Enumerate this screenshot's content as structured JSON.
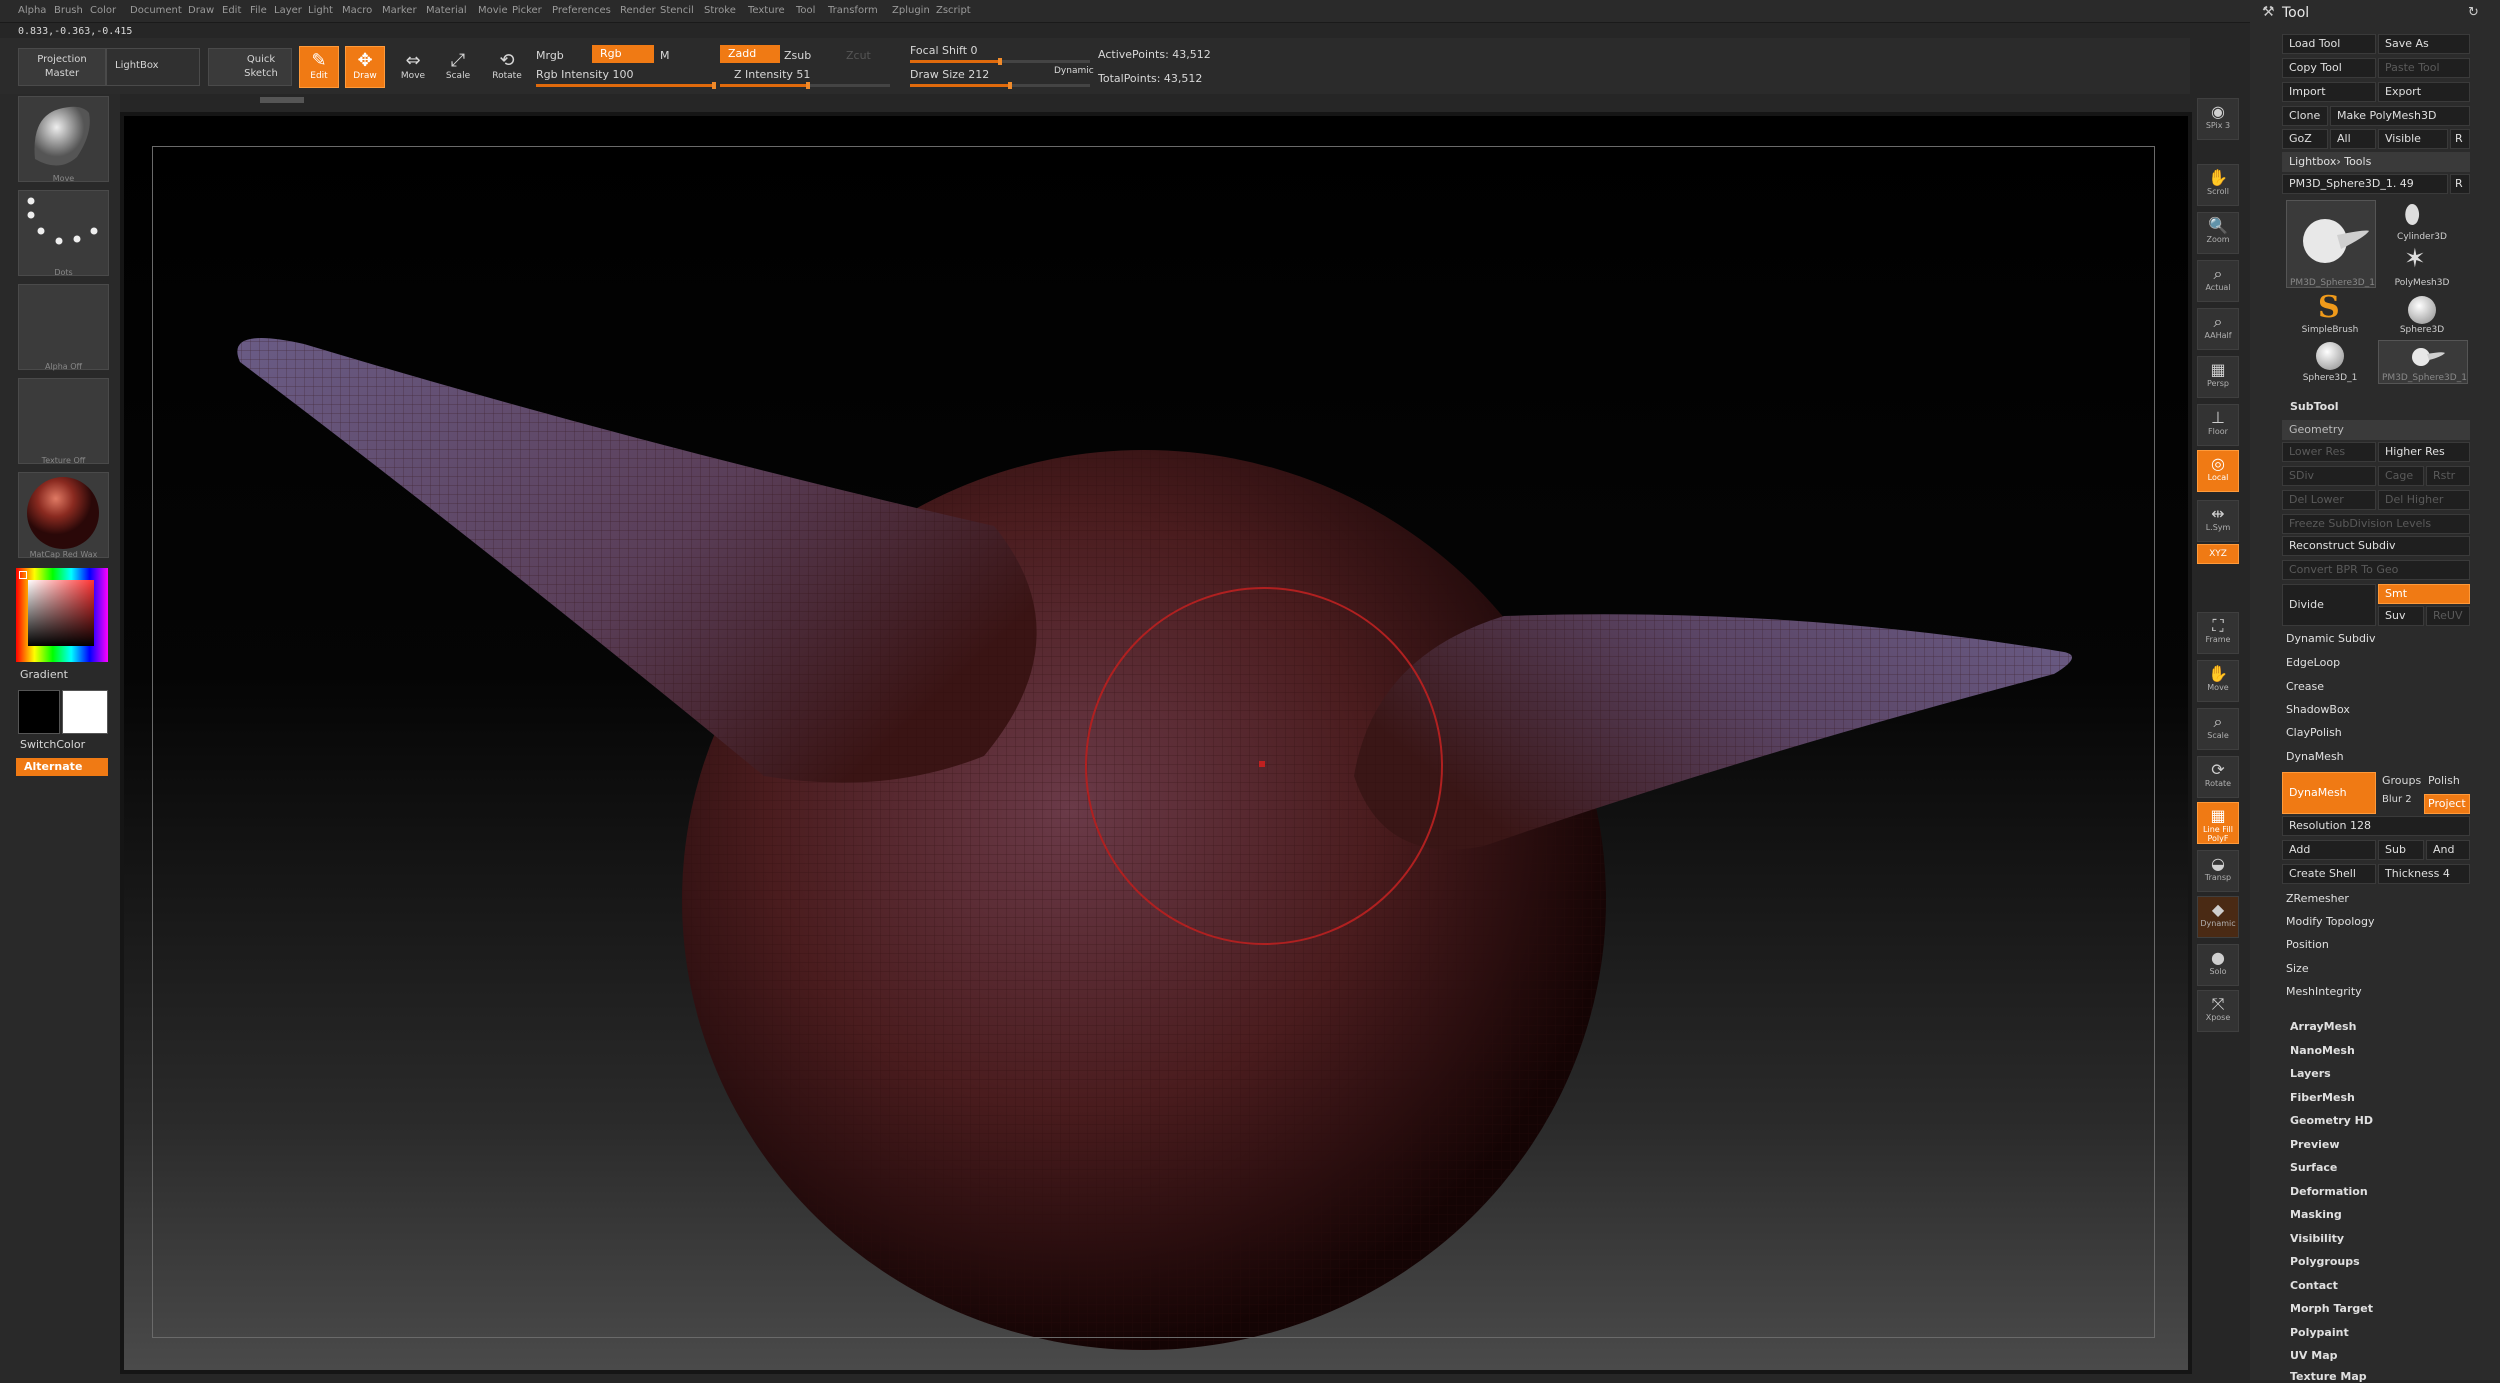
{
  "menu": [
    "Alpha",
    "Brush",
    "Color",
    "Document",
    "Draw",
    "Edit",
    "File",
    "Layer",
    "Light",
    "Macro",
    "Marker",
    "Material",
    "Movie",
    "Picker",
    "Preferences",
    "Render",
    "Stencil",
    "Stroke",
    "Texture",
    "Tool",
    "Transform",
    "Zplugin",
    "Zscript"
  ],
  "coords": "0.833,-0.363,-0.415",
  "shelf": {
    "projection_master": "Projection Master",
    "lightbox": "LightBox",
    "quick_sketch": "Quick Sketch",
    "edit": "Edit",
    "draw": "Draw",
    "move": "Move",
    "scale": "Scale",
    "rotate": "Rotate",
    "mrgb": "Mrgb",
    "rgb": "Rgb",
    "m": "M",
    "rgb_intensity": "Rgb Intensity 100",
    "zadd": "Zadd",
    "zsub": "Zsub",
    "zcut": "Zcut",
    "z_intensity": "Z Intensity 51",
    "focal_shift": "Focal Shift 0",
    "draw_size": "Draw Size 212",
    "dynamic": "Dynamic",
    "active_points": "ActivePoints: 43,512",
    "total_points": "TotalPoints: 43,512",
    "rgb_intensity_value": 100,
    "z_intensity_value": 51,
    "focal_shift_value": 0,
    "draw_size_value": 212
  },
  "left": {
    "brush": "Move",
    "stroke": "Dots",
    "alpha": "Alpha Off",
    "texture": "Texture Off",
    "material": "MatCap Red Wax",
    "gradient": "Gradient",
    "switchcolor": "SwitchColor",
    "alternate": "Alternate"
  },
  "right_shelf": [
    {
      "label": "SPix 3",
      "icon": "spix-icon"
    },
    {
      "label": "Scroll",
      "icon": "scroll-icon"
    },
    {
      "label": "Zoom",
      "icon": "zoom-icon"
    },
    {
      "label": "Actual",
      "icon": "actual-icon"
    },
    {
      "label": "AAHalf",
      "icon": "aahalf-icon"
    },
    {
      "label": "Persp",
      "icon": "persp-icon"
    },
    {
      "label": "Floor",
      "icon": "floor-icon"
    },
    {
      "label": "Local",
      "icon": "local-icon"
    },
    {
      "label": "L.Sym",
      "icon": "lsym-icon"
    },
    {
      "label": "XYZ",
      "icon": "xyz-icon"
    },
    {
      "label": "Frame",
      "icon": "frame-icon"
    },
    {
      "label": "Move",
      "icon": "move-icon"
    },
    {
      "label": "Scale",
      "icon": "scale-icon"
    },
    {
      "label": "Rotate",
      "icon": "rotate-icon"
    },
    {
      "label": "Line Fill PolyF",
      "icon": "polyf-icon"
    },
    {
      "label": "Transp",
      "icon": "transp-icon"
    },
    {
      "label": "Dynamic",
      "icon": "dynamic-icon"
    },
    {
      "label": "Solo",
      "icon": "solo-icon"
    },
    {
      "label": "Xpose",
      "icon": "xpose-icon"
    }
  ],
  "tool": {
    "title": "Tool",
    "load_tool": "Load Tool",
    "save_as": "Save As",
    "copy_tool": "Copy Tool",
    "paste_tool": "Paste Tool",
    "import": "Import",
    "export": "Export",
    "clone": "Clone",
    "make_polymesh": "Make PolyMesh3D",
    "goz": "GoZ",
    "all": "All",
    "visible": "Visible",
    "r": "R",
    "lightbox_tools": "Lightbox› Tools",
    "current_tool": "PM3D_Sphere3D_1. 49",
    "thumbs": [
      "PM3D_Sphere3D_1",
      "Cylinder3D",
      "PolyMesh3D",
      "SimpleBrush",
      "Sphere3D",
      "Sphere3D_1",
      "PM3D_Sphere3D_1"
    ],
    "subtool": "SubTool",
    "geometry": "Geometry",
    "lower_res": "Lower Res",
    "higher_res": "Higher Res",
    "sdiv": "SDiv",
    "cage": "Cage",
    "rstr": "Rstr",
    "del_lower": "Del Lower",
    "del_higher": "Del Higher",
    "freeze_subdiv": "Freeze SubDivision Levels",
    "reconstruct_subdiv": "Reconstruct Subdiv",
    "convert_bpr": "Convert BPR To Geo",
    "divide": "Divide",
    "smt": "Smt",
    "suv": "Suv",
    "reuv": "ReUV",
    "dynamic_subdiv": "Dynamic Subdiv",
    "edgeloop": "EdgeLoop",
    "crease": "Crease",
    "shadowbox": "ShadowBox",
    "claypolish": "ClayPolish",
    "dynamesh_hdr": "DynaMesh",
    "dynamesh_btn": "DynaMesh",
    "groups": "Groups",
    "polish": "Polish",
    "blur": "Blur 2",
    "project": "Project",
    "resolution": "Resolution 128",
    "add": "Add",
    "sub": "Sub",
    "and": "And",
    "create_shell": "Create Shell",
    "thickness": "Thickness 4",
    "zremesher": "ZRemesher",
    "modify_topology": "Modify Topology",
    "position": "Position",
    "size": "Size",
    "meshintegrity": "MeshIntegrity",
    "more": [
      "ArrayMesh",
      "NanoMesh",
      "Layers",
      "FiberMesh",
      "Geometry HD",
      "Preview",
      "Surface",
      "Deformation",
      "Masking",
      "Visibility",
      "Polygroups",
      "Contact",
      "Morph Target",
      "Polypaint",
      "UV Map",
      "Texture Map"
    ]
  },
  "colors": {
    "accent": "#f07a14",
    "panel": "#2b2b2b",
    "mesh": "#5a1e1e"
  }
}
